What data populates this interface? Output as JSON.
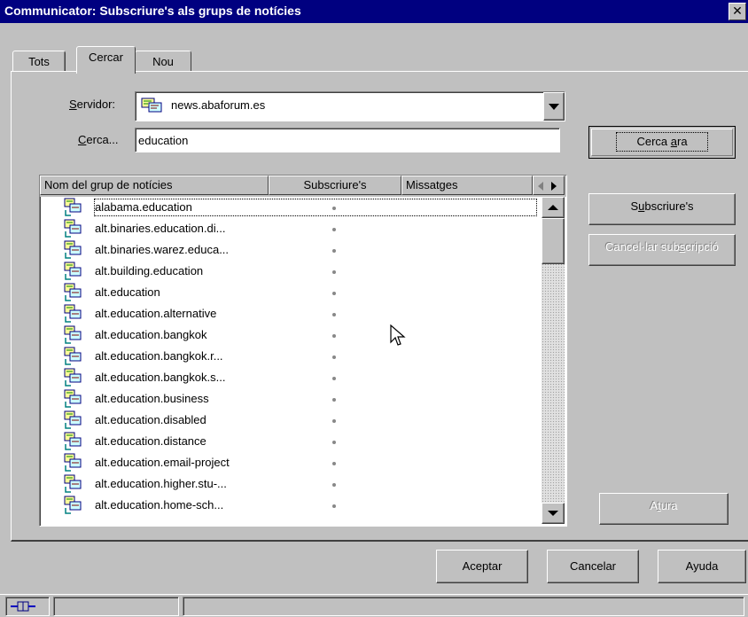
{
  "window": {
    "title": "Communicator: Subscriure's als grups de notícies",
    "close_label": "✕"
  },
  "tabs": [
    {
      "label": "Tots",
      "active": false
    },
    {
      "label": "Cercar",
      "active": true
    },
    {
      "label": "Nou",
      "active": false
    }
  ],
  "form": {
    "server_label": "Servidor:",
    "server_value": "news.abaforum.es",
    "search_label": "Cerca...",
    "search_value": "education"
  },
  "buttons": {
    "search_now": "Cerca ara",
    "subscribe": "Subscriure's",
    "unsubscribe": "Cancel·lar subscripció",
    "stop": "Atura",
    "accept": "Aceptar",
    "cancel": "Cancelar",
    "help": "Ayuda"
  },
  "list": {
    "columns": [
      "Nom del grup de notícies",
      "Subscriure's",
      "Missatges"
    ],
    "rows": [
      "alabama.education",
      "alt.binaries.education.di...",
      "alt.binaries.warez.educa...",
      "alt.building.education",
      "alt.education",
      "alt.education.alternative",
      "alt.education.bangkok",
      "alt.education.bangkok.r...",
      "alt.education.bangkok.s...",
      "alt.education.business",
      "alt.education.disabled",
      "alt.education.distance",
      "alt.education.email-project",
      "alt.education.higher.stu-...",
      "alt.education.home-sch..."
    ]
  },
  "icons": {
    "server": "newsgroup-server-icon",
    "row": "newsgroup-icon",
    "status": "connection-icon"
  },
  "colors": {
    "titlebar": "#000080",
    "face": "#c0c0c0",
    "disabled_text": "#ffffff"
  }
}
